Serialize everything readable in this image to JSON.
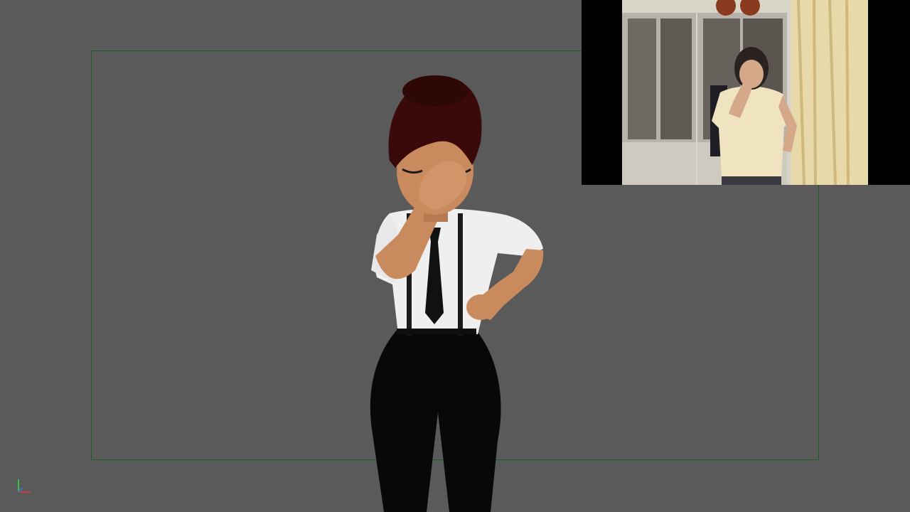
{
  "viewport": {
    "background_color": "#5a5a5a",
    "safe_frame_color": "#1f5a2a"
  },
  "character": {
    "pose": "facepalm",
    "colors": {
      "hair": "#3a0a0a",
      "skin": "#c98a5e",
      "shirt": "#efefef",
      "tie": "#111111",
      "suspenders": "#1a1a1a",
      "pants": "#080808"
    }
  },
  "reference_video": {
    "pose": "facepalm",
    "colors": {
      "letterbox": "#000000",
      "wall": "#d9d4c8",
      "cabinet": "#b8b3aa",
      "curtain": "#e8d9a8",
      "top": "#efe3c0"
    }
  },
  "axis_gizmo": {
    "icon": "axis-gizmo-icon",
    "colors": {
      "x": "#d23b3b",
      "y": "#3bbf4a",
      "z": "#3b6fd2"
    }
  }
}
